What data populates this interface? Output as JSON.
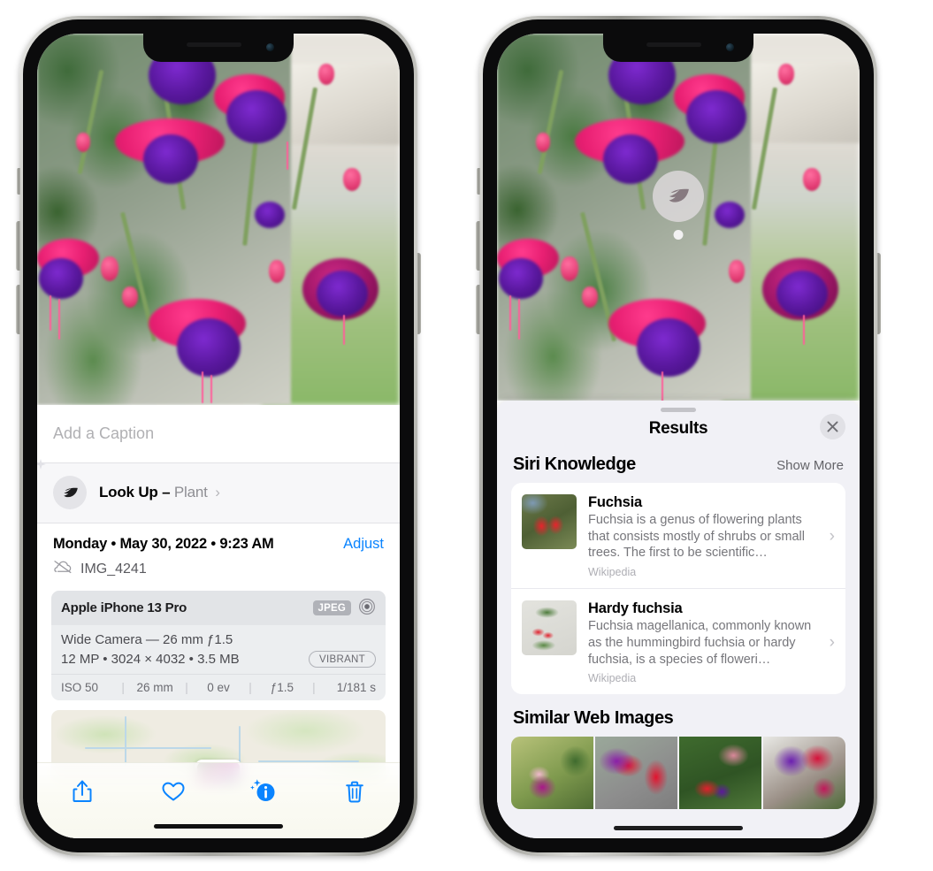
{
  "left_phone": {
    "name": "photos-detail-view",
    "caption_placeholder": "Add a Caption",
    "lookup": {
      "label": "Look Up –",
      "subject": "Plant",
      "chevron": "›",
      "icon": "leaf-icon"
    },
    "date": "Monday • May 30, 2022 • 9:23 AM",
    "adjust_label": "Adjust",
    "file_name": "IMG_4241",
    "file_icon": "cloud-slash-icon",
    "exif": {
      "device": "Apple iPhone 13 Pro",
      "format_badge": "JPEG",
      "lens_icon": "aperture-icon",
      "lens_line": "Wide Camera — 26 mm ƒ1.5",
      "size_line": "12 MP • 3024 × 4032 • 3.5 MB",
      "style_badge": "VIBRANT",
      "settings": [
        "ISO 50",
        "26 mm",
        "0 ev",
        "ƒ1.5",
        "1/181 s"
      ],
      "separator": "|"
    },
    "toolbar": [
      {
        "label": "Share",
        "icon": "share-icon",
        "active": false
      },
      {
        "label": "Favorite",
        "icon": "heart-icon",
        "active": false
      },
      {
        "label": "Info",
        "icon": "info-sparkle-icon",
        "active": true
      },
      {
        "label": "Delete",
        "icon": "trash-icon",
        "active": false
      }
    ]
  },
  "right_phone": {
    "name": "visual-lookup-results",
    "badge_icon": "leaf-icon",
    "sheet_title": "Results",
    "close_icon": "close-icon",
    "siri_section": {
      "title": "Siri Knowledge",
      "action": "Show More",
      "items": [
        {
          "title": "Fuchsia",
          "description": "Fuchsia is a genus of flowering plants that consists mostly of shrubs or small trees. The first to be scientific…",
          "source": "Wikipedia",
          "chevron": "›"
        },
        {
          "title": "Hardy fuchsia",
          "description": "Fuchsia magellanica, commonly known as the hummingbird fuchsia or hardy fuchsia, is a species of floweri…",
          "source": "Wikipedia",
          "chevron": "›"
        }
      ]
    },
    "web_section": {
      "title": "Similar Web Images",
      "thumbnails": [
        "fuchsia-pink-white-bloom",
        "fuchsia-red-closeup",
        "fuchsia-shrub-buds",
        "fuchsia-purple-red-double"
      ]
    }
  },
  "colors": {
    "accent_blue": "#0a84ff",
    "sheet_bg": "#f1f1f6",
    "card_bg": "#ffffff",
    "secondary_text": "#8e8e93",
    "tertiary_text": "#aeaeb4"
  }
}
